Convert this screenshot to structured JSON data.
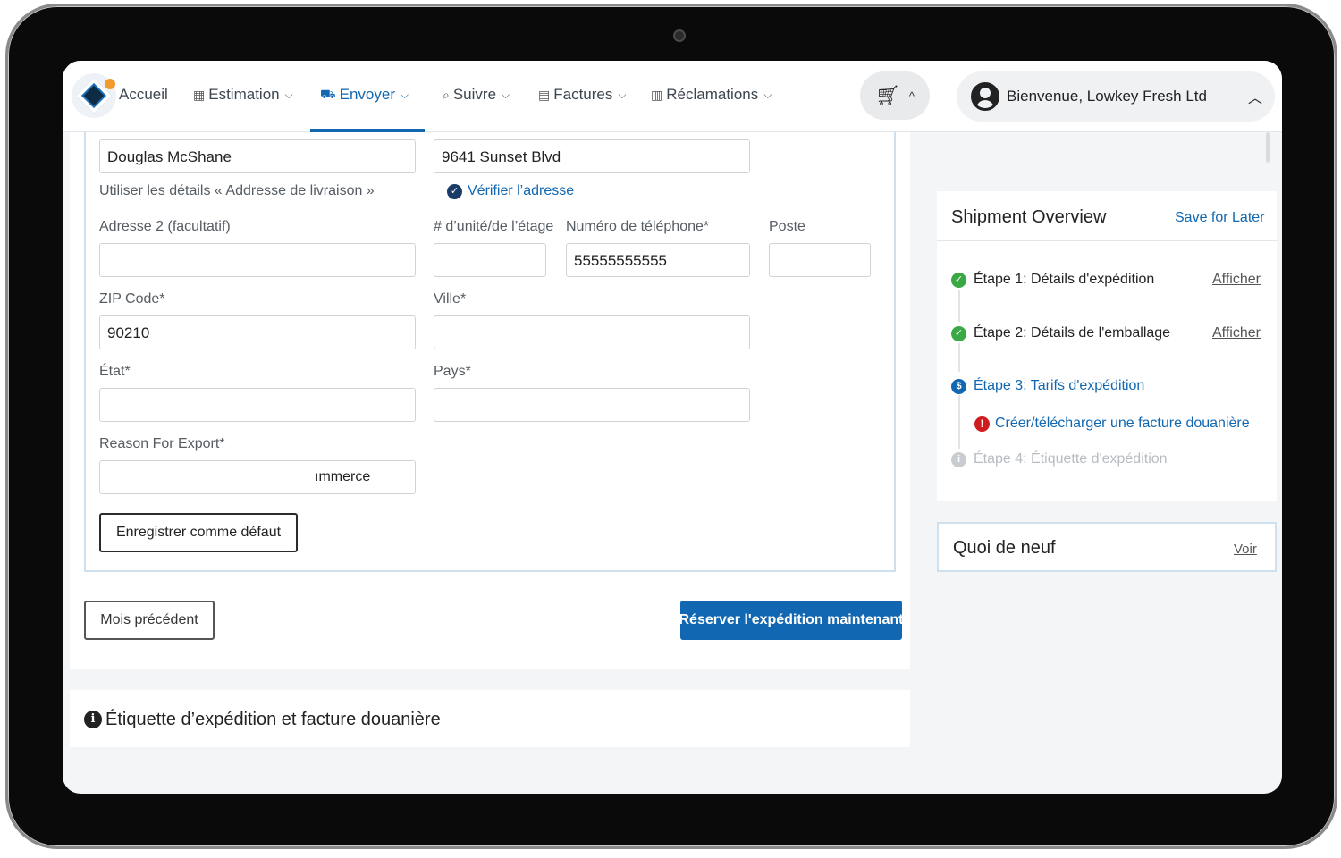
{
  "nav": {
    "items": [
      {
        "label": "Accueil",
        "icon": "home",
        "has_chevron": false
      },
      {
        "label": "Estimation",
        "icon": "calculator-icon",
        "has_chevron": true
      },
      {
        "label": "Envoyer",
        "icon": "truck-icon",
        "has_chevron": true,
        "active": true
      },
      {
        "label": "Suivre",
        "icon": "search-icon",
        "has_chevron": true
      },
      {
        "label": "Factures",
        "icon": "invoice-icon",
        "has_chevron": true
      },
      {
        "label": "Réclamations",
        "icon": "document-icon",
        "has_chevron": true
      }
    ],
    "cart_icon": "cart-icon",
    "user_greeting": "Bienvenue, Lowkey Fresh Ltd"
  },
  "form": {
    "name_value": "Douglas McShane",
    "address_value": "9641 Sunset Blvd",
    "use_details_label": "Utiliser les détails « Addresse de livraison »",
    "verify_label": "Vérifier l’adresse",
    "address2_label": "Adresse 2 (facultatif)",
    "address2_value": "",
    "unit_label": "# d’unité/de l’étage",
    "unit_value": "",
    "phone_label": "Numéro de téléphone*",
    "phone_value": "55555555555",
    "ext_label": "Poste",
    "ext_value": "",
    "zip_label": "ZIP Code*",
    "zip_value": "90210",
    "city_label": "Ville*",
    "city_value": "",
    "state_label": "État*",
    "state_value": "",
    "country_label": "Pays*",
    "country_value": "",
    "reason_label": "Reason For Export*",
    "reason_value": "ımmerce",
    "save_default_label": "Enregistrer comme défaut",
    "prev_label": "Mois précédent",
    "book_label": "Réserver l'expédition maintenant"
  },
  "label_section": {
    "title": "Étiquette d’expédition et facture douanière"
  },
  "overview": {
    "title": "Shipment Overview",
    "save_link": "Save for Later",
    "steps": [
      {
        "label": "Étape 1: Détails d'expédition",
        "status": "done",
        "link": "Afficher"
      },
      {
        "label": "Étape 2: Détails de l'emballage",
        "status": "done",
        "link": "Afficher"
      },
      {
        "label": "Étape 3: Tarifs d'expédition",
        "status": "current",
        "link": ""
      },
      {
        "label": "Étape 4: Étiquette d'expédition",
        "status": "todo",
        "link": ""
      }
    ],
    "substep_label": "Créer/télécharger une facture douanière"
  },
  "whats_new": {
    "title": "Quoi de neuf",
    "link": "Voir"
  },
  "colors": {
    "accent": "#1167b1",
    "success": "#3aa845",
    "error": "#d01c1c"
  }
}
